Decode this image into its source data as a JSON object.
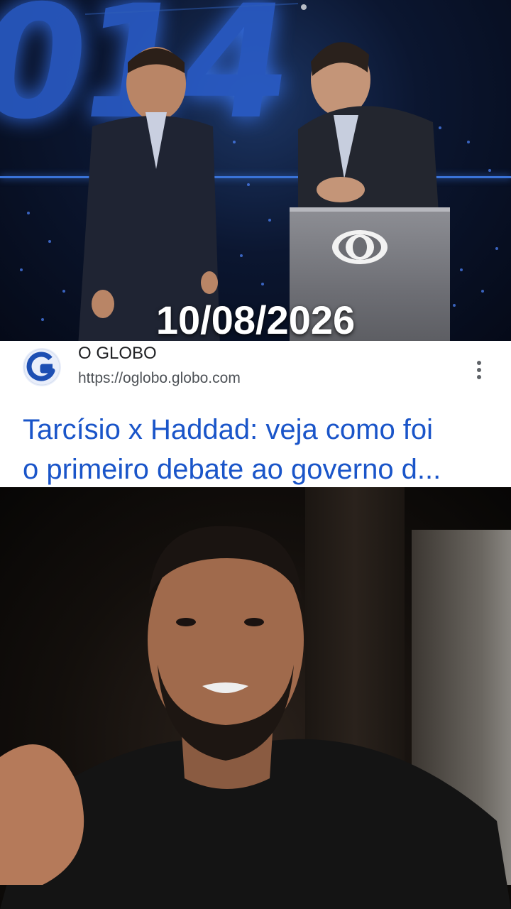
{
  "top_image": {
    "date_overlay": "10/08/2026"
  },
  "result": {
    "site_name": "O GLOBO",
    "site_url": "https://oglobo.globo.com",
    "title_line1": "Tarcísio x Haddad: veja como foi",
    "title_line2": "o primeiro debate ao governo d...",
    "logo_letter": "G"
  },
  "icons": {
    "site_logo": "globe-g-logo",
    "menu": "more-vert-icon",
    "broadcaster": "eye-logo"
  },
  "colors": {
    "link_blue": "#1a55c9",
    "logo_blue": "#1d4fb3",
    "card_bg": "#ffffff"
  }
}
